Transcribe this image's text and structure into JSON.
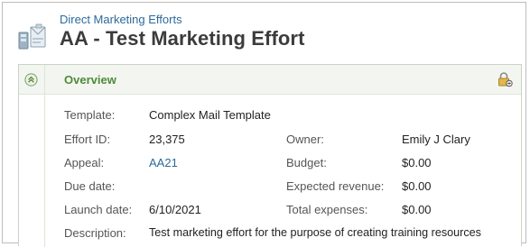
{
  "header": {
    "breadcrumb": "Direct Marketing Efforts",
    "title": "AA - Test Marketing Effort",
    "icon": "marketing-effort-icon"
  },
  "panel": {
    "title": "Overview",
    "collapse_icon": "chevron-double-up-icon",
    "lock_icon": "lock-icon"
  },
  "fields": {
    "template_label": "Template:",
    "template_value": "Complex Mail Template",
    "effort_id_label": "Effort ID:",
    "effort_id_value": "23,375",
    "owner_label": "Owner:",
    "owner_value": "Emily J Clary",
    "appeal_label": "Appeal:",
    "appeal_value": "AA21",
    "budget_label": "Budget:",
    "budget_value": "$0.00",
    "due_date_label": "Due date:",
    "due_date_value": "",
    "expected_revenue_label": "Expected revenue:",
    "expected_revenue_value": "$0.00",
    "launch_date_label": "Launch date:",
    "launch_date_value": "6/10/2021",
    "total_expenses_label": "Total expenses:",
    "total_expenses_value": "$0.00",
    "description_label": "Description:",
    "description_value": "Test marketing effort for the purpose of creating training resources"
  },
  "colors": {
    "link": "#2b6a9c",
    "panel_title": "#4e8a3a",
    "panel_header_bg": "#f3f6f0"
  }
}
